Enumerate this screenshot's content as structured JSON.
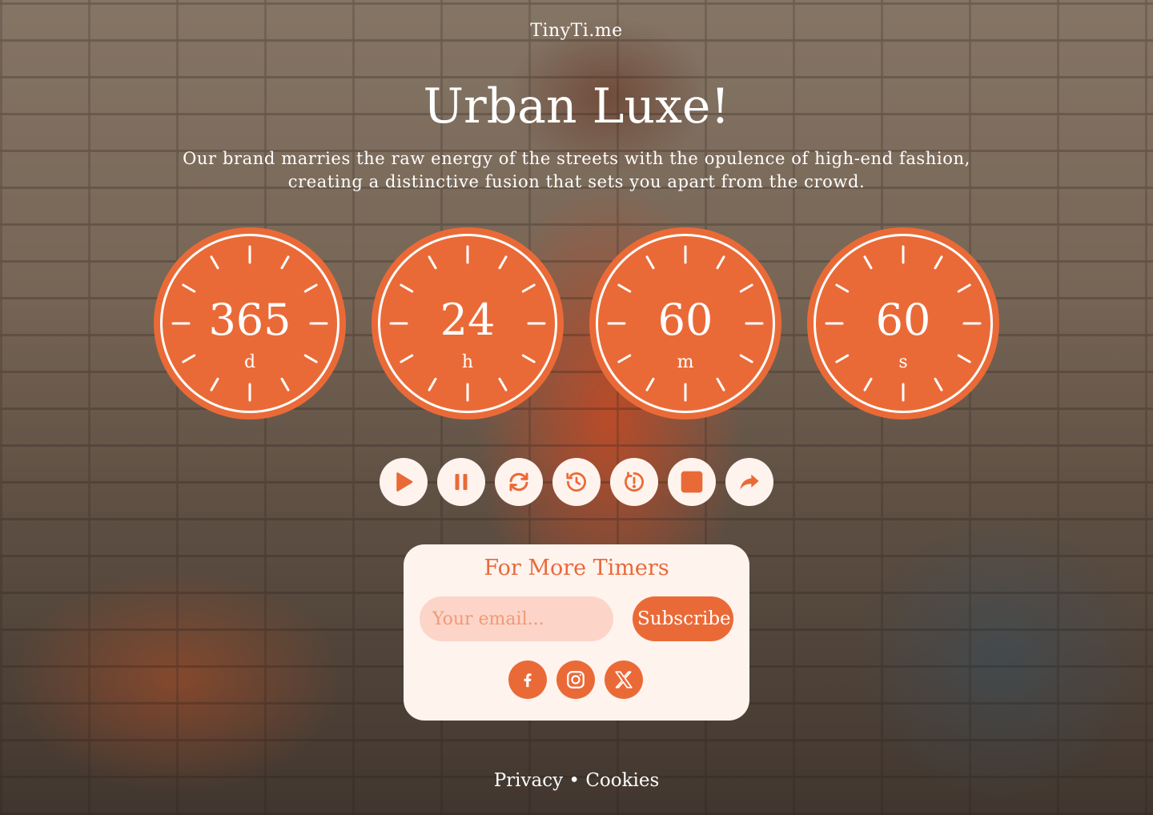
{
  "brand": "TinyTi.me",
  "headline": "Urban Luxe!",
  "description": "Our brand marries the raw energy of the streets with the opulence of high-end fashion, creating a distinctive fusion that sets you apart from the crowd.",
  "timers": [
    {
      "value": "365",
      "unit": "d"
    },
    {
      "value": "24",
      "unit": "h"
    },
    {
      "value": "60",
      "unit": "m"
    },
    {
      "value": "60",
      "unit": "s"
    }
  ],
  "controls": [
    {
      "icon": "play-icon"
    },
    {
      "icon": "pause-icon"
    },
    {
      "icon": "refresh-icon"
    },
    {
      "icon": "history-icon"
    },
    {
      "icon": "timer-reset-icon"
    },
    {
      "icon": "stop-icon"
    },
    {
      "icon": "share-icon"
    }
  ],
  "subscribe_card": {
    "title": "For More Timers",
    "email_placeholder": "Your email...",
    "button_label": "Subscribe"
  },
  "socials": [
    {
      "icon": "facebook-icon"
    },
    {
      "icon": "instagram-icon"
    },
    {
      "icon": "x-icon"
    }
  ],
  "footer": {
    "privacy": "Privacy",
    "separator": "•",
    "cookies": "Cookies"
  },
  "colors": {
    "accent": "#ea6a37",
    "card_bg": "#fff3ee",
    "input_bg": "#fcd5c8"
  }
}
